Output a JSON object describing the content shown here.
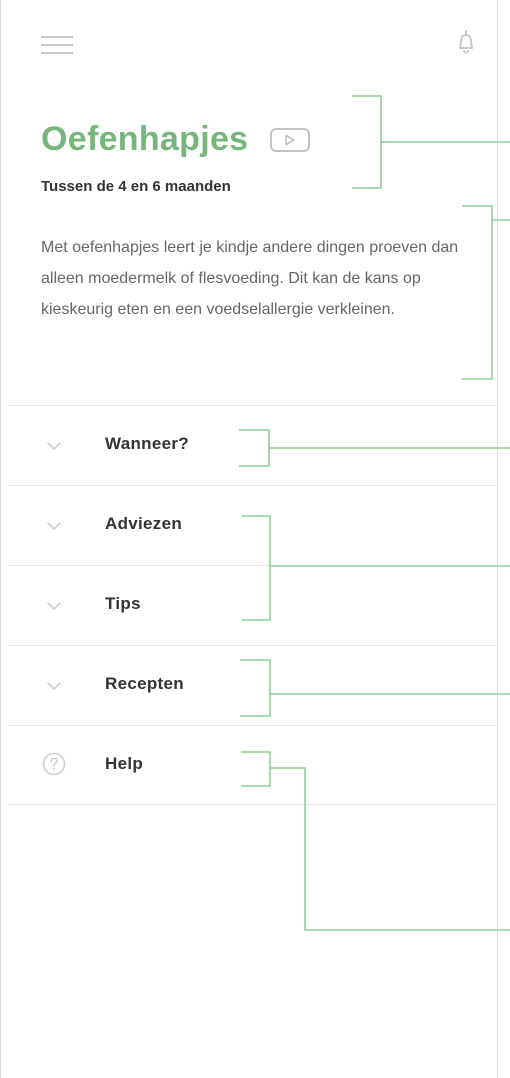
{
  "header": {
    "menu_icon": "hamburger-icon",
    "notification_icon": "bell-icon"
  },
  "page": {
    "title": "Oefenhapjes",
    "video_icon": "play-icon",
    "subtitle": "Tussen de 4 en 6 maanden",
    "intro": "Met oefenhapjes leert je kindje andere dingen proeven dan alleen moedermelk of flesvoeding. Dit kan de kans op kieskeurig eten en een voedselallergie verkleinen."
  },
  "menu": {
    "items": [
      {
        "label": "Wanneer?",
        "icon": "chevron-down-icon"
      },
      {
        "label": "Adviezen",
        "icon": "chevron-down-icon"
      },
      {
        "label": "Tips",
        "icon": "chevron-down-icon"
      },
      {
        "label": "Recepten",
        "icon": "chevron-down-icon"
      },
      {
        "label": "Help",
        "icon": "help-icon"
      }
    ]
  },
  "colors": {
    "accent": "#76b67a",
    "annotation": "#8fcf95",
    "text": "#333333",
    "muted": "#666666",
    "divider": "#e6e6e6"
  }
}
